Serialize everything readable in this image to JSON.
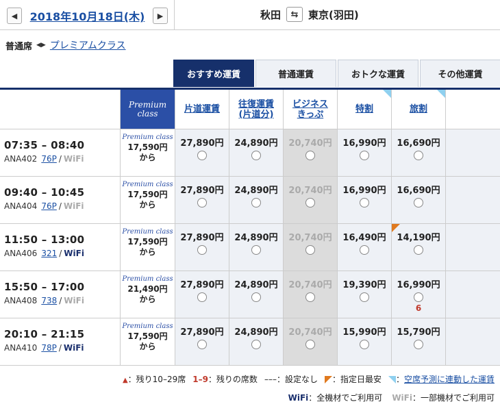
{
  "header": {
    "prev": "◀",
    "date": "2018年10月18日(木)",
    "next": "▶",
    "origin": "秋田",
    "swap": "⇆",
    "destination": "東京(羽田)"
  },
  "class_selector": {
    "current": "普通席",
    "arrows": "◀▶",
    "other": "プレミアムクラス"
  },
  "tabs": [
    "おすすめ運賃",
    "普通運賃",
    "おトクな運賃",
    "その他運賃"
  ],
  "columns": {
    "premium_line1": "Premium",
    "premium_line2": "class",
    "fares": [
      {
        "l1": "片道運賃",
        "l2": "",
        "blue_corner": false
      },
      {
        "l1": "往復運賃",
        "l2": "(片道分)",
        "blue_corner": false
      },
      {
        "l1": "ビジネス",
        "l2": "きっぷ",
        "blue_corner": false
      },
      {
        "l1": "特割",
        "l2": "",
        "blue_corner": true
      },
      {
        "l1": "旅割",
        "l2": "",
        "blue_corner": true
      }
    ]
  },
  "flights": [
    {
      "time": "07:35 – 08:40",
      "flight": "ANA402",
      "plane": "76P",
      "wifi": "WiFi",
      "wifi_full": false,
      "prem_logo": "Premium class",
      "prem_price": "17,590円",
      "prem_from": "から",
      "fares": [
        "27,890円",
        "24,890円",
        "20,740円",
        "16,990円",
        "16,690円"
      ],
      "seats": [
        "",
        "",
        "",
        "",
        ""
      ]
    },
    {
      "time": "09:40 – 10:45",
      "flight": "ANA404",
      "plane": "76P",
      "wifi": "WiFi",
      "wifi_full": false,
      "prem_logo": "Premium class",
      "prem_price": "17,590円",
      "prem_from": "から",
      "fares": [
        "27,890円",
        "24,890円",
        "20,740円",
        "16,990円",
        "16,690円"
      ],
      "seats": [
        "",
        "",
        "",
        "",
        ""
      ]
    },
    {
      "time": "11:50 – 13:00",
      "flight": "ANA406",
      "plane": "321",
      "wifi": "WiFi",
      "wifi_full": true,
      "prem_logo": "Premium class",
      "prem_price": "17,590円",
      "prem_from": "から",
      "fares": [
        "27,890円",
        "24,890円",
        "20,740円",
        "16,490円",
        "14,190円"
      ],
      "seats": [
        "",
        "",
        "",
        "",
        ""
      ]
    },
    {
      "time": "15:50 – 17:00",
      "flight": "ANA408",
      "plane": "738",
      "wifi": "WiFi",
      "wifi_full": false,
      "prem_logo": "Premium class",
      "prem_price": "21,490円",
      "prem_from": "から",
      "fares": [
        "27,890円",
        "24,890円",
        "20,740円",
        "19,390円",
        "16,990円"
      ],
      "seats": [
        "",
        "",
        "",
        "",
        "6"
      ]
    },
    {
      "time": "20:10 – 21:15",
      "flight": "ANA410",
      "plane": "78P",
      "wifi": "WiFi",
      "wifi_full": true,
      "prem_logo": "Premium class",
      "prem_price": "17,590円",
      "prem_from": "から",
      "fares": [
        "27,890円",
        "24,890円",
        "20,740円",
        "15,990円",
        "15,790円"
      ],
      "seats": [
        "",
        "",
        "",
        "",
        ""
      ]
    }
  ],
  "legend": {
    "triangle": "▲",
    "remaining_range": "：残り10–29席",
    "seat_count_num": "1–9",
    "seat_count_label": "：残りの席数",
    "no_setting_mark": "–––",
    "no_setting_label": "：設定なし",
    "special_day_label": "：指定日最安",
    "linked_fare_prefix": "：",
    "linked_fare_link": "空席予測に連動した運賃",
    "wifi_all_mark": "WiFi",
    "wifi_all_label": "：全機材でご利用可",
    "wifi_some_mark": "WiFi",
    "wifi_some_label": "：一部機材でご利用可"
  },
  "colors": {
    "navy": "#16306b",
    "premium_blue": "#2b4fa6",
    "link": "#1a4fa3",
    "seat_red": "#c0392b"
  }
}
